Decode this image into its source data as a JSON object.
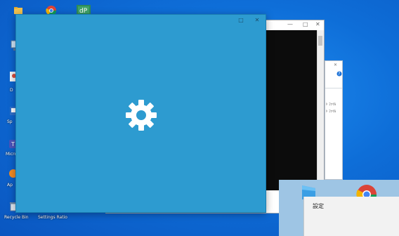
{
  "desktop": {
    "labels": {
      "recycle": "Recycle Bin",
      "settings": "Settings Ratio"
    }
  },
  "settings_window": {
    "maximize_glyph": "□",
    "close_glyph": "✕",
    "background_color": "#2d9bd0",
    "icon": "gear-icon"
  },
  "console_window": {
    "minimize_glyph": "—",
    "maximize_glyph": "□",
    "close_glyph": "✕"
  },
  "explorer_window": {
    "close_glyph": "✕",
    "rows": [
      "ﾄ ﾌｧｲﾙ",
      "ﾄ ﾌｧｲﾙ"
    ]
  },
  "start_menu": {
    "item_label": "設定"
  }
}
